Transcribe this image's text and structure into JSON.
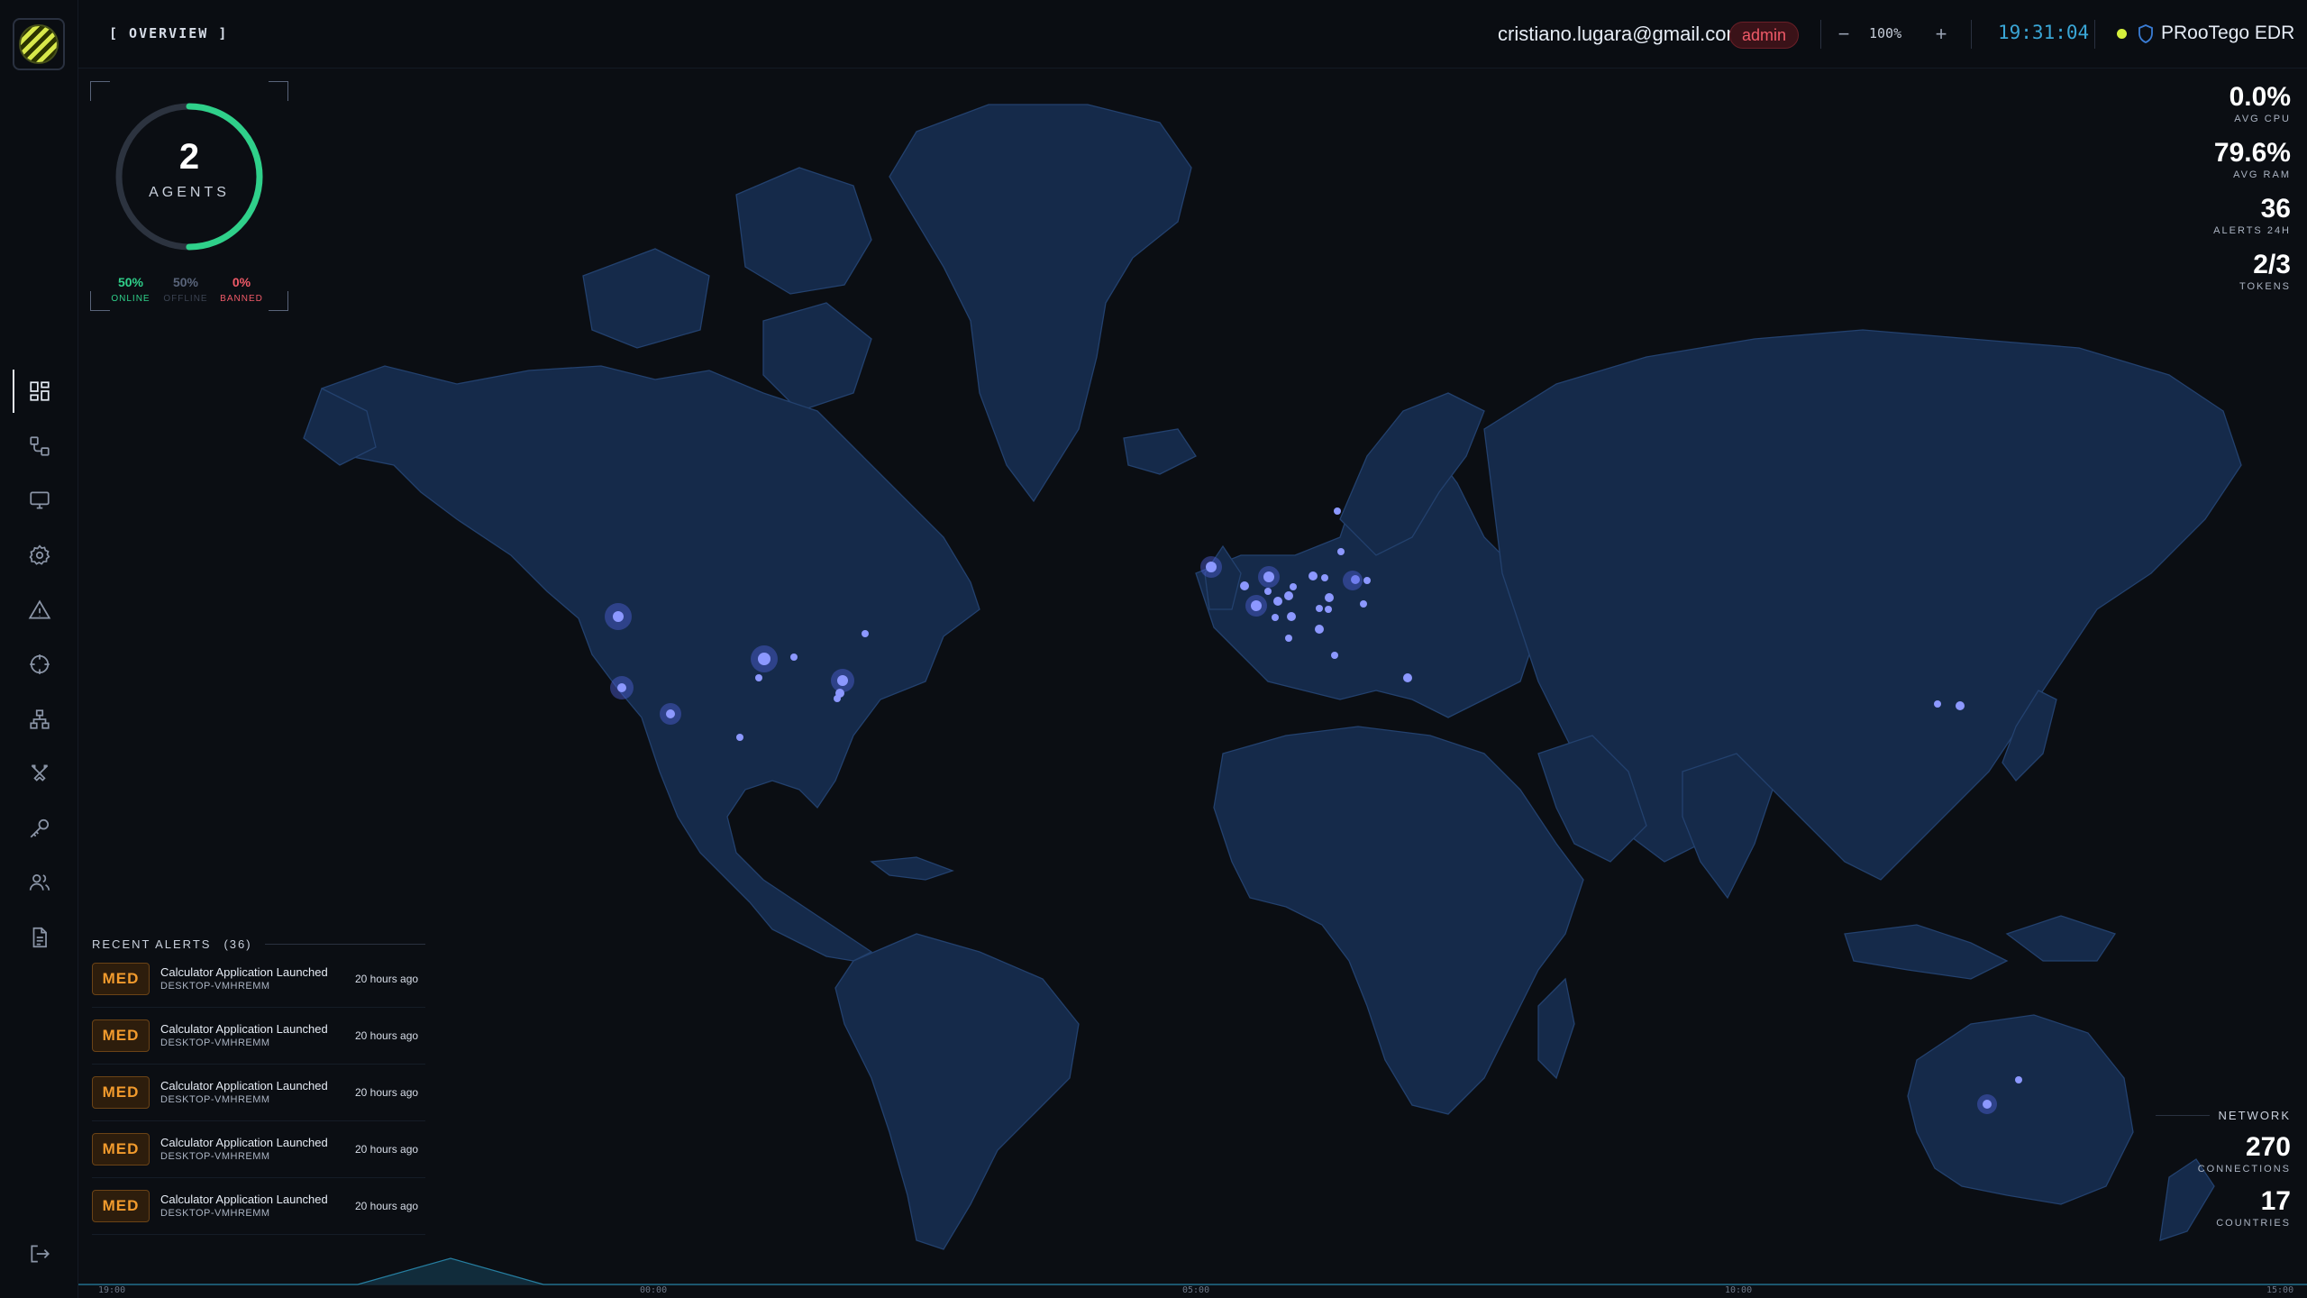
{
  "header": {
    "page_title": "[ OVERVIEW ]",
    "user_email": "cristiano.lugara@gmail.com",
    "role": "admin",
    "zoom_out": "−",
    "zoom_level": "100%",
    "zoom_in": "+",
    "clock": "19:31:04",
    "brand": "PRooTego EDR"
  },
  "sidebar": {
    "items": [
      {
        "name": "dashboard-icon",
        "active": true
      },
      {
        "name": "workflow-icon"
      },
      {
        "name": "monitor-icon"
      },
      {
        "name": "gear-icon"
      },
      {
        "name": "warning-icon"
      },
      {
        "name": "crosshair-icon"
      },
      {
        "name": "network-tree-icon"
      },
      {
        "name": "swords-icon"
      },
      {
        "name": "key-icon"
      },
      {
        "name": "users-icon"
      },
      {
        "name": "document-icon"
      }
    ],
    "logout": "logout-icon"
  },
  "agents": {
    "count": "2",
    "label": "AGENTS",
    "online_value": "50%",
    "online_label": "ONLINE",
    "offline_value": "50%",
    "offline_label": "OFFLINE",
    "banned_value": "0%",
    "banned_label": "BANNED",
    "online_fraction": 0.5
  },
  "metrics": [
    {
      "value": "0.0%",
      "label": "AVG CPU"
    },
    {
      "value": "79.6%",
      "label": "AVG RAM"
    },
    {
      "value": "36",
      "label": "ALERTS 24H"
    },
    {
      "value": "2/3",
      "label": "TOKENS"
    }
  ],
  "alerts": {
    "title": "RECENT ALERTS",
    "count": "(36)",
    "items": [
      {
        "severity": "MED",
        "title": "Calculator Application Launched",
        "host": "DESKTOP-VMHREMM",
        "time": "20 hours ago"
      },
      {
        "severity": "MED",
        "title": "Calculator Application Launched",
        "host": "DESKTOP-VMHREMM",
        "time": "20 hours ago"
      },
      {
        "severity": "MED",
        "title": "Calculator Application Launched",
        "host": "DESKTOP-VMHREMM",
        "time": "20 hours ago"
      },
      {
        "severity": "MED",
        "title": "Calculator Application Launched",
        "host": "DESKTOP-VMHREMM",
        "time": "20 hours ago"
      },
      {
        "severity": "MED",
        "title": "Calculator Application Launched",
        "host": "DESKTOP-VMHREMM",
        "time": "20 hours ago"
      }
    ]
  },
  "network": {
    "title": "NETWORK",
    "connections_value": "270",
    "connections_label": "CONNECTIONS",
    "countries_value": "17",
    "countries_label": "COUNTRIES"
  },
  "timeline": {
    "ticks": [
      "19:00",
      "00:00",
      "05:00",
      "10:00",
      "15:00"
    ]
  },
  "colors": {
    "online": "#2fd08a",
    "offline": "#3b4352",
    "banned": "#f05a68",
    "accent": "#3aa6d6",
    "severity_med": "#f29b2d"
  }
}
